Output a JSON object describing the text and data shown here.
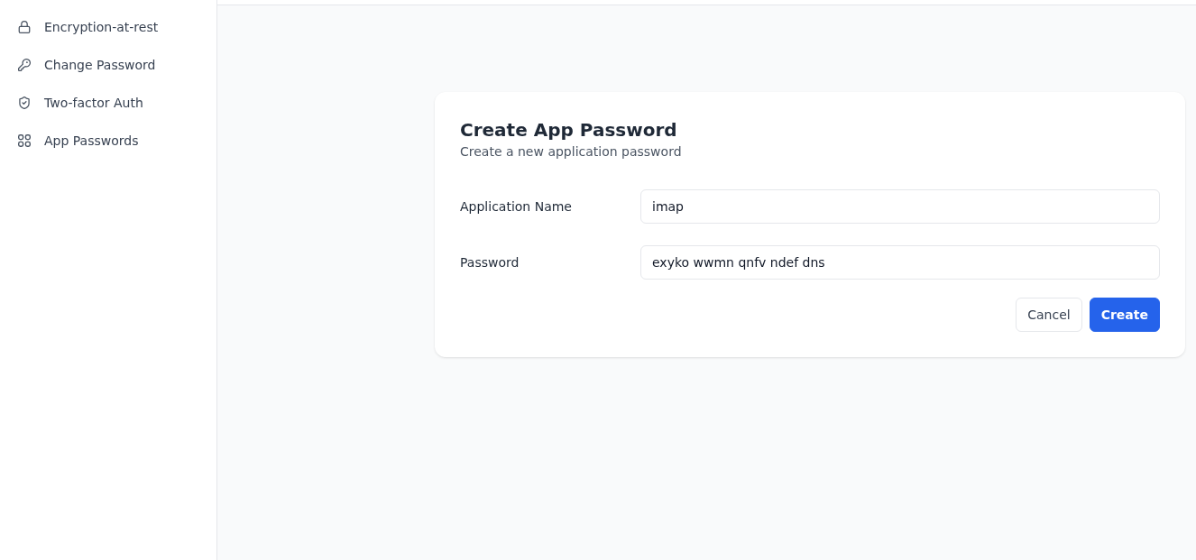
{
  "sidebar": {
    "items": [
      {
        "label": "Encryption-at-rest",
        "selected": false
      },
      {
        "label": "Change Password",
        "selected": false
      },
      {
        "label": "Two-factor Auth",
        "selected": false
      },
      {
        "label": "App Passwords",
        "selected": false
      }
    ]
  },
  "card": {
    "title": "Create App Password",
    "subtitle": "Create a new application password",
    "fields": [
      {
        "label": "Application Name",
        "value": "imap"
      },
      {
        "label": "Password",
        "value": "exyko wwmn qnfv ndef dns"
      }
    ],
    "buttons": [
      {
        "label": "Cancel",
        "kind": "secondary"
      },
      {
        "label": "Create",
        "kind": "primary"
      }
    ]
  }
}
